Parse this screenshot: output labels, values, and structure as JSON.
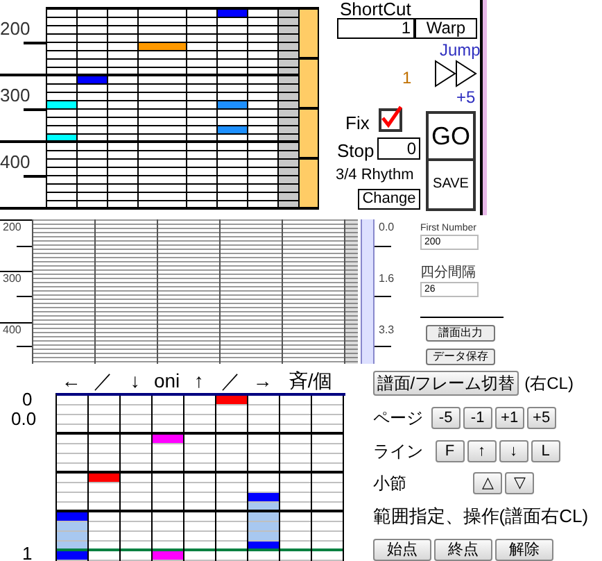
{
  "top_grid": {
    "axis_labels": [
      "200",
      "300",
      "400"
    ],
    "lanes": [
      {
        "cells": [
          null,
          null,
          null,
          null,
          null,
          null,
          null,
          null,
          null,
          null,
          null,
          {
            "color": "#00ffff"
          },
          null,
          null,
          null,
          {
            "color": "#00ffff"
          },
          null,
          null,
          null,
          null,
          null,
          null,
          null,
          null
        ]
      },
      {
        "cells": [
          null,
          null,
          null,
          null,
          null,
          null,
          null,
          null,
          {
            "color": "#0000ff"
          },
          null,
          null,
          null,
          null,
          null,
          null,
          null,
          null,
          null,
          null,
          null,
          null,
          null,
          null,
          null
        ]
      },
      {
        "cells": [
          null,
          null,
          null,
          null,
          null,
          null,
          null,
          null,
          null,
          null,
          null,
          null,
          null,
          null,
          null,
          null,
          null,
          null,
          null,
          null,
          null,
          null,
          null,
          null
        ]
      },
      {
        "cells": [
          null,
          null,
          null,
          null,
          {
            "color": "#ff9900"
          },
          null,
          null,
          null,
          null,
          null,
          null,
          null,
          null,
          null,
          null,
          null,
          null,
          null,
          null,
          null,
          null,
          null,
          null,
          null
        ]
      },
      {
        "cells": [
          null,
          null,
          null,
          null,
          null,
          null,
          null,
          null,
          null,
          null,
          null,
          null,
          null,
          null,
          null,
          null,
          null,
          null,
          null,
          null,
          null,
          null,
          null,
          null
        ]
      },
      {
        "cells": [
          {
            "color": "#0000ff"
          },
          null,
          null,
          null,
          null,
          null,
          null,
          null,
          null,
          null,
          null,
          {
            "color": "#1e90ff"
          },
          null,
          null,
          {
            "color": "#1e90ff"
          },
          null,
          null,
          null,
          null,
          null,
          null,
          null,
          null,
          null
        ]
      },
      {
        "cells": [
          null,
          null,
          null,
          null,
          null,
          null,
          null,
          null,
          null,
          null,
          null,
          null,
          null,
          null,
          null,
          null,
          null,
          null,
          null,
          null,
          null,
          null,
          null,
          null
        ]
      }
    ]
  },
  "top_panel": {
    "shortcut_label": "ShortCut",
    "shortcut_value": "1",
    "warp_button": "Warp",
    "jump_label": "Jump",
    "jump_value": "1",
    "jump_step": "+5",
    "fix_label": "Fix",
    "fix_checked": true,
    "stop_label": "Stop",
    "stop_value": "0",
    "rhythm_label": "3/4 Rhythm",
    "change_button": "Change",
    "go_button": "GO",
    "save_button": "SAVE"
  },
  "overview": {
    "axis_labels": [
      "200",
      "300",
      "400"
    ],
    "time_labels": [
      "0.0",
      "1.6",
      "3.3"
    ]
  },
  "settings": {
    "first_number_label": "First Number",
    "first_number_value": "200",
    "interval_label": "四分間隔",
    "interval_value": "26",
    "buttons": [
      "譜面出力",
      "データ保存"
    ]
  },
  "editor": {
    "headers": [
      "←",
      "／",
      "↓",
      "oni",
      "↑",
      "／",
      "→",
      "斉/個"
    ],
    "measure_label": "0",
    "time_label": "0.0",
    "end_label": "1",
    "lanes": [
      {
        "cells": [
          null,
          null,
          null,
          null,
          null,
          null,
          null,
          null,
          null,
          null,
          null,
          null,
          {
            "color": "#0000ff"
          },
          {
            "color": "#a8c8f0"
          },
          {
            "color": "#a8c8f0"
          },
          {
            "color": "#a8c8f0"
          },
          {
            "color": "#0000ff"
          }
        ]
      },
      {
        "cells": [
          null,
          null,
          null,
          null,
          null,
          null,
          null,
          null,
          {
            "color": "#ff0000"
          },
          null,
          null,
          null,
          null,
          null,
          null,
          null,
          null
        ]
      },
      {
        "cells": [
          null,
          null,
          null,
          null,
          null,
          null,
          null,
          null,
          null,
          null,
          null,
          null,
          null,
          null,
          null,
          null,
          null
        ]
      },
      {
        "cells": [
          null,
          null,
          null,
          null,
          {
            "color": "#ff00ff"
          },
          null,
          null,
          null,
          null,
          null,
          null,
          null,
          null,
          null,
          null,
          null,
          {
            "color": "#ff00ff"
          }
        ]
      },
      {
        "cells": [
          null,
          null,
          null,
          null,
          null,
          null,
          null,
          null,
          null,
          null,
          null,
          null,
          null,
          null,
          null,
          null,
          null
        ]
      },
      {
        "cells": [
          {
            "color": "#ff0000"
          },
          null,
          null,
          null,
          null,
          null,
          null,
          null,
          null,
          null,
          null,
          null,
          null,
          null,
          null,
          null,
          null
        ]
      },
      {
        "cells": [
          null,
          null,
          null,
          null,
          null,
          null,
          null,
          null,
          null,
          null,
          {
            "color": "#0000ff"
          },
          {
            "color": "#a8c8f0"
          },
          {
            "color": "#a8c8f0"
          },
          {
            "color": "#a8c8f0"
          },
          {
            "color": "#a8c8f0"
          },
          {
            "color": "#0000ff"
          },
          null
        ]
      },
      {
        "cells": [
          null,
          null,
          null,
          null,
          null,
          null,
          null,
          null,
          null,
          null,
          null,
          null,
          null,
          null,
          null,
          null,
          null
        ]
      },
      {
        "cells": [
          null,
          null,
          null,
          null,
          null,
          null,
          null,
          null,
          null,
          null,
          null,
          null,
          null,
          null,
          null,
          null,
          null
        ]
      }
    ]
  },
  "controls": {
    "switch_button": "譜面/フレーム切替",
    "switch_hint": "(右CL)",
    "page_label": "ページ",
    "page_buttons": [
      "-5",
      "-1",
      "+1",
      "+5"
    ],
    "line_label": "ライン",
    "line_buttons": [
      "F",
      "↑",
      "↓",
      "L"
    ],
    "measure_label": "小節",
    "measure_buttons": [
      "△",
      "▽"
    ],
    "range_label": "範囲指定、操作(譜面右CL)",
    "range_buttons": [
      "始点",
      "終点",
      "解除"
    ]
  }
}
